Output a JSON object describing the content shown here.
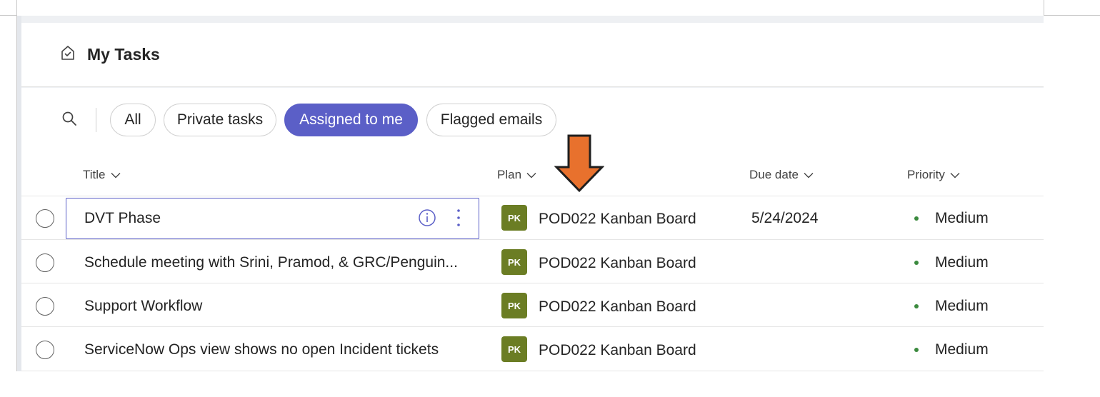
{
  "page": {
    "title": "My Tasks"
  },
  "filters": {
    "search_icon": "search-icon",
    "pills": [
      {
        "label": "All",
        "active": false
      },
      {
        "label": "Private tasks",
        "active": false
      },
      {
        "label": "Assigned to me",
        "active": true
      },
      {
        "label": "Flagged emails",
        "active": false
      }
    ]
  },
  "columns": {
    "title": "Title",
    "plan": "Plan",
    "due_date": "Due date",
    "priority": "Priority"
  },
  "tasks": [
    {
      "title": "DVT Phase",
      "plan_initials": "PK",
      "plan": "POD022 Kanban Board",
      "due": "5/24/2024",
      "priority": "Medium"
    },
    {
      "title": "Schedule meeting with Srini, Pramod, & GRC/Penguin...",
      "plan_initials": "PK",
      "plan": "POD022 Kanban Board",
      "due": "",
      "priority": "Medium"
    },
    {
      "title": "Support Workflow",
      "plan_initials": "PK",
      "plan": "POD022 Kanban Board",
      "due": "",
      "priority": "Medium"
    },
    {
      "title": "ServiceNow Ops view shows no open Incident tickets",
      "plan_initials": "PK",
      "plan": "POD022 Kanban Board",
      "due": "",
      "priority": "Medium"
    }
  ],
  "colors": {
    "accent": "#5b5fc7",
    "plan_badge": "#6b7d24",
    "priority_medium": "#3b8a3e",
    "annotation_arrow": "#e8712d"
  },
  "annotation": {
    "icon": "down-arrow-icon"
  }
}
